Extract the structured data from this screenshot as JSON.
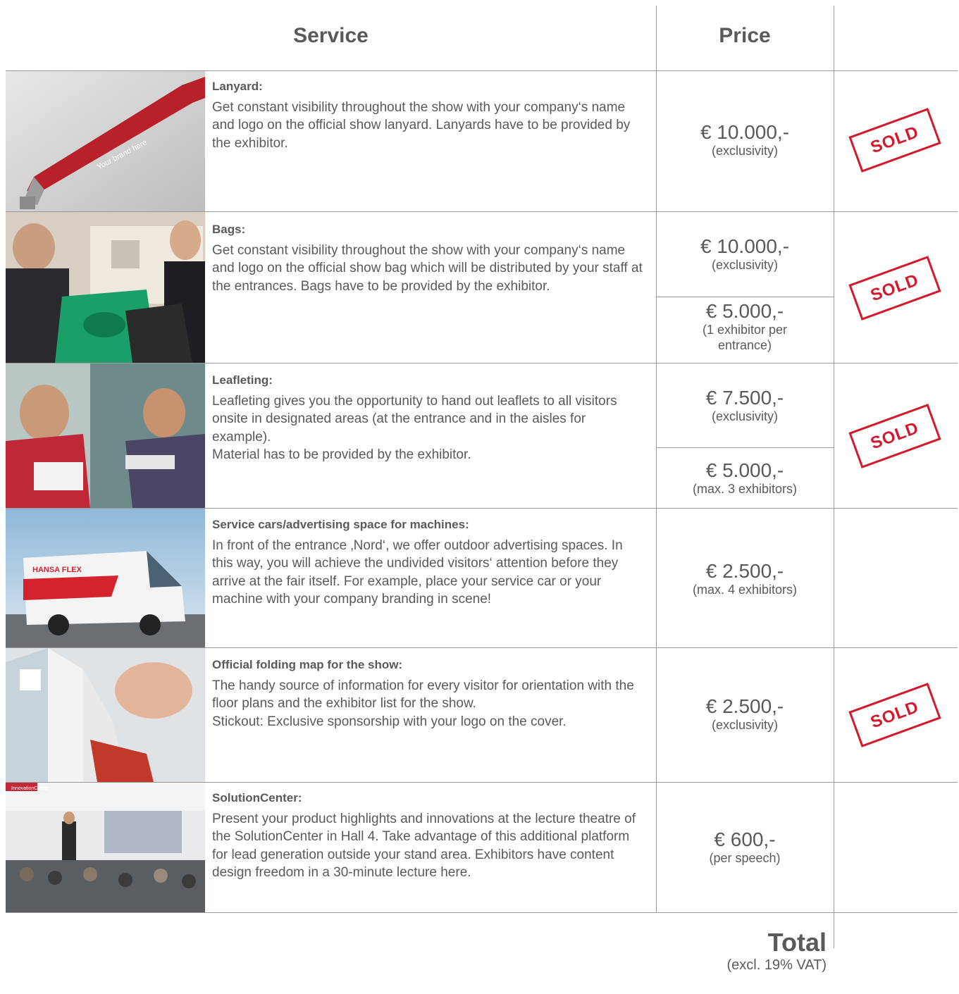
{
  "header": {
    "service": "Service",
    "price": "Price"
  },
  "rows": [
    {
      "title": "Lanyard:",
      "paragraphs": [
        "Get constant visibility throughout the show with your company‘s name and logo on the official show lanyard. Lanyards have to be provided by the exhibitor."
      ],
      "image_text": "Your brand here",
      "prices": [
        {
          "amount": "€ 10.000,-",
          "note": "(exclusivity)"
        }
      ],
      "sold": "SOLD"
    },
    {
      "title": "Bags:",
      "paragraphs": [
        "Get constant visibility throughout the show with your company‘s name and logo on the official show bag which will be distributed by your staff at the entrances. Bags have to be provided by the exhibitor."
      ],
      "prices": [
        {
          "amount": "€ 10.000,-",
          "note": "(exclusivity)"
        },
        {
          "amount": "€ 5.000,-",
          "note": "(1 exhibitor per entrance)"
        }
      ],
      "sold": "SOLD"
    },
    {
      "title": "Leafleting:",
      "paragraphs": [
        "Leafleting gives you the opportunity to hand out leaflets to all visitors onsite in designated areas (at the entrance and in the aisles for example).",
        "Material has to be provided by the exhibitor."
      ],
      "prices": [
        {
          "amount": "€ 7.500,-",
          "note": "(exclusivity)"
        },
        {
          "amount": "€ 5.000,-",
          "note": "(max. 3 exhibitors)"
        }
      ],
      "sold": "SOLD"
    },
    {
      "title": "Service cars/advertising space for machines:",
      "paragraphs": [
        "In front of the entrance ‚Nord‘, we offer outdoor advertising spaces. In this way, you will achieve the undivided visitors‘ attention before they arrive at the fair itself. For example, place your service car or your machine with your company branding in scene!"
      ],
      "image_text": "HANSA FLEX",
      "prices": [
        {
          "amount": "€ 2.500,-",
          "note": "(max. 4 exhibitors)"
        }
      ],
      "sold": ""
    },
    {
      "title": "Official folding map for the show:",
      "paragraphs": [
        "The handy source of information for every visitor for orientation with the floor plans and the exhibitor list for the show.",
        "Stickout: Exclusive sponsorship with your logo on the cover."
      ],
      "prices": [
        {
          "amount": "€ 2.500,-",
          "note": "(exclusivity)"
        }
      ],
      "sold": "SOLD"
    },
    {
      "title": "SolutionCenter:",
      "paragraphs": [
        "Present your product highlights and innovations at the lecture theatre of the SolutionCenter in Hall 4. Take advantage of this additional platform for lead generation outside your stand area. Exhibitors have content design freedom in a 30-minute lecture here."
      ],
      "image_text": "InnovationCenter",
      "prices": [
        {
          "amount": "€ 600,-",
          "note": "(per speech)"
        }
      ],
      "sold": ""
    }
  ],
  "total": {
    "label": "Total",
    "note": "(excl. 19% VAT)"
  },
  "colors": {
    "sold_red": "#d21a2c",
    "text": "#5a5a5a",
    "line": "#9a9a9a"
  }
}
